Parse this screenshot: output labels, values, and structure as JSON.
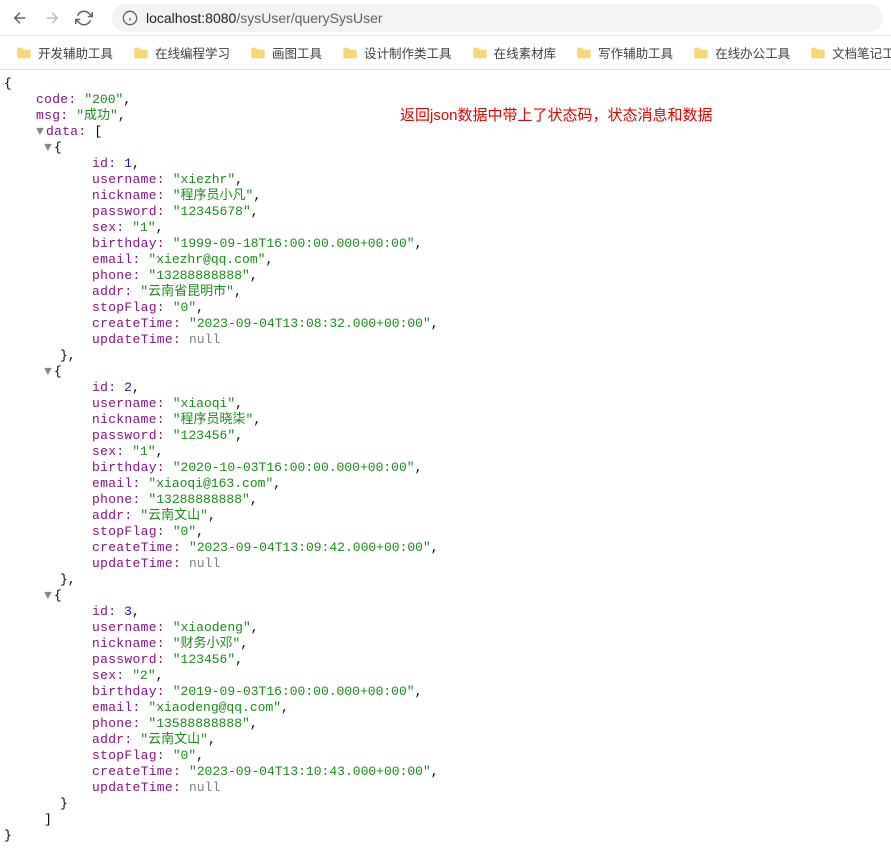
{
  "browser": {
    "url_host": "localhost:",
    "url_port": "8080",
    "url_path": "/sysUser/querySysUser"
  },
  "bookmarks": [
    {
      "label": "开发辅助工具"
    },
    {
      "label": "在线编程学习"
    },
    {
      "label": "画图工具"
    },
    {
      "label": "设计制作类工具"
    },
    {
      "label": "在线素材库"
    },
    {
      "label": "写作辅助工具"
    },
    {
      "label": "在线办公工具"
    },
    {
      "label": "文档笔记工具"
    }
  ],
  "annotation": "返回json数据中带上了状态码，状态消息和数据",
  "response": {
    "code": "200",
    "msg": "成功",
    "data": [
      {
        "id": 1,
        "username": "xiezhr",
        "nickname": "程序员小凡",
        "password": "12345678",
        "sex": "1",
        "birthday": "1999-09-18T16:00:00.000+00:00",
        "email": "xiezhr@qq.com",
        "phone": "13288888888",
        "addr": "云南省昆明市",
        "stopFlag": "0",
        "createTime": "2023-09-04T13:08:32.000+00:00",
        "updateTime": null
      },
      {
        "id": 2,
        "username": "xiaoqi",
        "nickname": "程序员晓柒",
        "password": "123456",
        "sex": "1",
        "birthday": "2020-10-03T16:00:00.000+00:00",
        "email": "xiaoqi@163.com",
        "phone": "13288888888",
        "addr": "云南文山",
        "stopFlag": "0",
        "createTime": "2023-09-04T13:09:42.000+00:00",
        "updateTime": null
      },
      {
        "id": 3,
        "username": "xiaodeng",
        "nickname": "财务小邓",
        "password": "123456",
        "sex": "2",
        "birthday": "2019-09-03T16:00:00.000+00:00",
        "email": "xiaodeng@qq.com",
        "phone": "13588888888",
        "addr": "云南文山",
        "stopFlag": "0",
        "createTime": "2023-09-04T13:10:43.000+00:00",
        "updateTime": null
      }
    ]
  },
  "labels": {
    "code": "code",
    "msg": "msg",
    "data": "data",
    "id": "id",
    "username": "username",
    "nickname": "nickname",
    "password": "password",
    "sex": "sex",
    "birthday": "birthday",
    "email": "email",
    "phone": "phone",
    "addr": "addr",
    "stopFlag": "stopFlag",
    "createTime": "createTime",
    "updateTime": "updateTime",
    "null": "null"
  }
}
